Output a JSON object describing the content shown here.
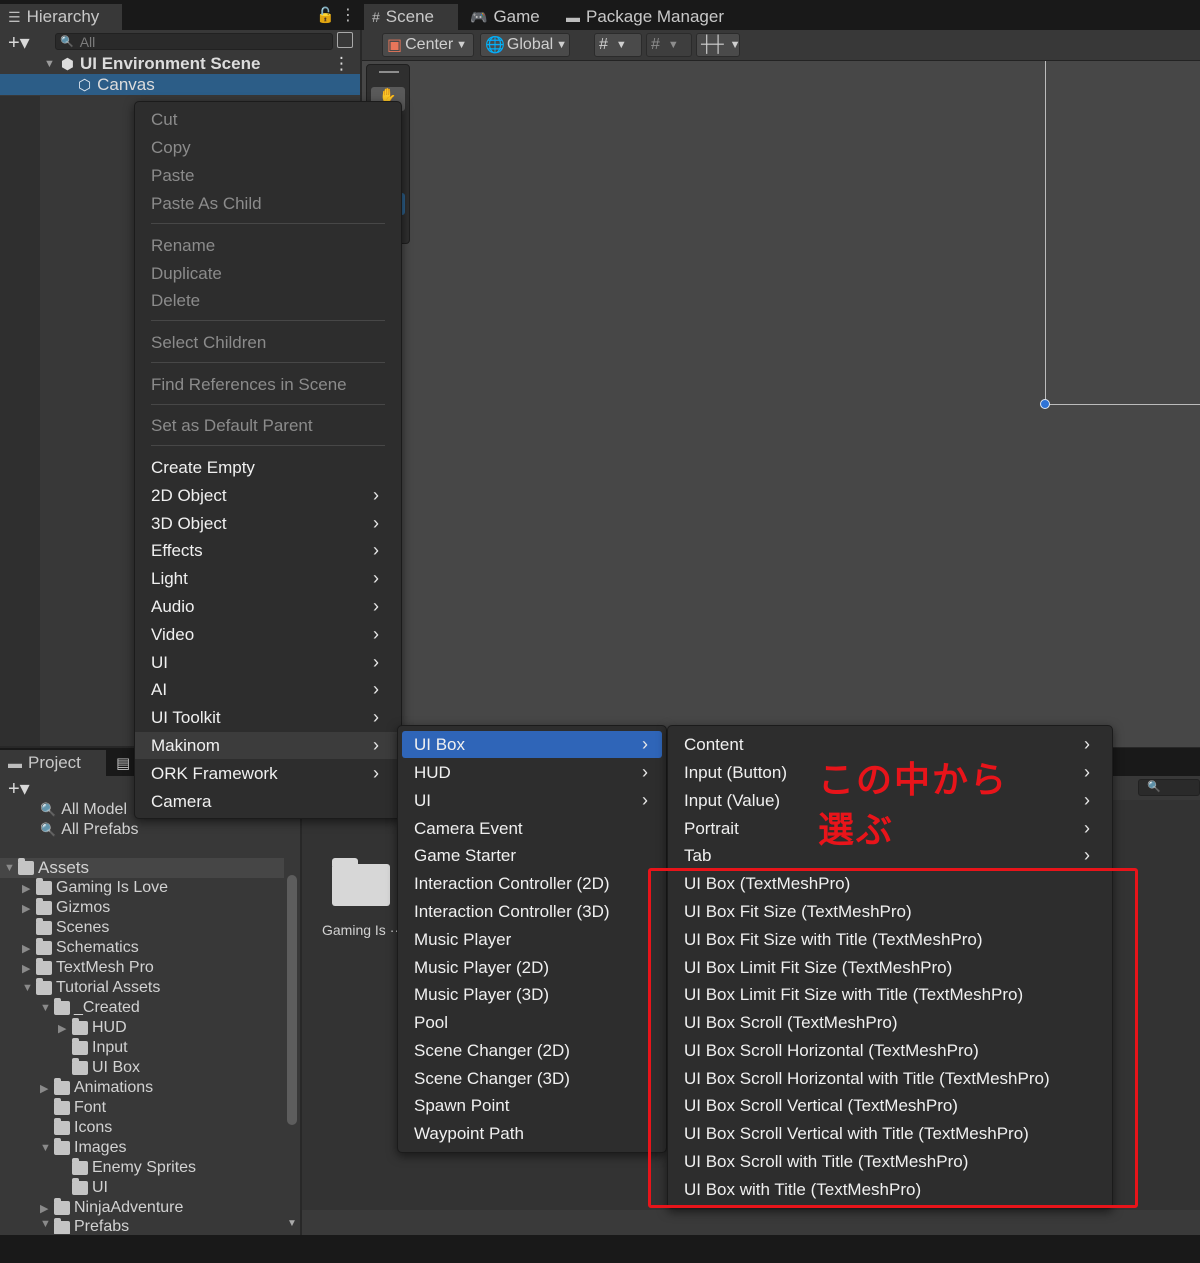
{
  "tabs": {
    "hierarchy": "Hierarchy",
    "scene": "Scene",
    "game": "Game",
    "package_manager": "Package Manager",
    "project": "Project"
  },
  "hierarchy": {
    "search_placeholder": "All",
    "scene_name": "UI Environment Scene",
    "selected_object": "Canvas"
  },
  "scene_toolbar": {
    "pivot": "Center",
    "space": "Global"
  },
  "context_menu": {
    "items": [
      {
        "label": "Cut",
        "enabled": false
      },
      {
        "label": "Copy",
        "enabled": false
      },
      {
        "label": "Paste",
        "enabled": false
      },
      {
        "label": "Paste As Child",
        "enabled": false
      },
      {
        "label": "Rename",
        "enabled": false
      },
      {
        "label": "Duplicate",
        "enabled": false
      },
      {
        "label": "Delete",
        "enabled": false
      },
      {
        "label": "Select Children",
        "enabled": false
      },
      {
        "label": "Find References in Scene",
        "enabled": false
      },
      {
        "label": "Set as Default Parent",
        "enabled": false
      },
      {
        "label": "Create Empty",
        "enabled": true
      },
      {
        "label": "2D Object",
        "enabled": true,
        "submenu": true
      },
      {
        "label": "3D Object",
        "enabled": true,
        "submenu": true
      },
      {
        "label": "Effects",
        "enabled": true,
        "submenu": true
      },
      {
        "label": "Light",
        "enabled": true,
        "submenu": true
      },
      {
        "label": "Audio",
        "enabled": true,
        "submenu": true
      },
      {
        "label": "Video",
        "enabled": true,
        "submenu": true
      },
      {
        "label": "UI",
        "enabled": true,
        "submenu": true
      },
      {
        "label": "AI",
        "enabled": true,
        "submenu": true
      },
      {
        "label": "UI Toolkit",
        "enabled": true,
        "submenu": true
      },
      {
        "label": "Makinom",
        "enabled": true,
        "submenu": true
      },
      {
        "label": "ORK Framework",
        "enabled": true,
        "submenu": true
      },
      {
        "label": "Camera",
        "enabled": true
      }
    ]
  },
  "makinom_menu": {
    "items": [
      {
        "label": "UI Box",
        "submenu": true
      },
      {
        "label": "HUD",
        "submenu": true
      },
      {
        "label": "UI",
        "submenu": true
      },
      {
        "label": "Camera Event"
      },
      {
        "label": "Game Starter"
      },
      {
        "label": "Interaction Controller (2D)"
      },
      {
        "label": "Interaction Controller (3D)"
      },
      {
        "label": "Music Player"
      },
      {
        "label": "Music Player (2D)"
      },
      {
        "label": "Music Player (3D)"
      },
      {
        "label": "Pool"
      },
      {
        "label": "Scene Changer (2D)"
      },
      {
        "label": "Scene Changer (3D)"
      },
      {
        "label": "Spawn Point"
      },
      {
        "label": "Waypoint Path"
      }
    ]
  },
  "uibox_menu": {
    "items": [
      {
        "label": "Content",
        "submenu": true
      },
      {
        "label": "Input (Button)",
        "submenu": true
      },
      {
        "label": "Input (Value)",
        "submenu": true
      },
      {
        "label": "Portrait",
        "submenu": true
      },
      {
        "label": "Tab",
        "submenu": true
      },
      {
        "label": "UI Box (TextMeshPro)"
      },
      {
        "label": "UI Box Fit Size (TextMeshPro)"
      },
      {
        "label": "UI Box Fit Size with Title (TextMeshPro)"
      },
      {
        "label": "UI Box Limit Fit Size (TextMeshPro)"
      },
      {
        "label": "UI Box Limit Fit Size with Title (TextMeshPro)"
      },
      {
        "label": "UI Box Scroll (TextMeshPro)"
      },
      {
        "label": "UI Box Scroll Horizontal (TextMeshPro)"
      },
      {
        "label": "UI Box Scroll Horizontal with Title (TextMeshPro)"
      },
      {
        "label": "UI Box Scroll Vertical (TextMeshPro)"
      },
      {
        "label": "UI Box Scroll Vertical with Title (TextMeshPro)"
      },
      {
        "label": "UI Box Scroll with Title (TextMeshPro)"
      },
      {
        "label": "UI Box with Title (TextMeshPro)"
      }
    ]
  },
  "annotation": {
    "line1": "この中から",
    "line2": "選ぶ",
    "color": "#e8141a"
  },
  "project": {
    "favorites": [
      "All Model",
      "All Prefabs"
    ],
    "tree": [
      {
        "label": "Assets",
        "depth": 0,
        "expanded": true
      },
      {
        "label": "Gaming Is Love",
        "depth": 1,
        "expanded": false
      },
      {
        "label": "Gizmos",
        "depth": 1,
        "expanded": false
      },
      {
        "label": "Scenes",
        "depth": 1,
        "leaf": true
      },
      {
        "label": "Schematics",
        "depth": 1,
        "expanded": false
      },
      {
        "label": "TextMesh Pro",
        "depth": 1,
        "expanded": false
      },
      {
        "label": "Tutorial Assets",
        "depth": 1,
        "expanded": true
      },
      {
        "label": "_Created",
        "depth": 2,
        "expanded": true
      },
      {
        "label": "HUD",
        "depth": 3,
        "expanded": false
      },
      {
        "label": "Input",
        "depth": 3,
        "leaf": true
      },
      {
        "label": "UI Box",
        "depth": 3,
        "leaf": true
      },
      {
        "label": "Animations",
        "depth": 2,
        "expanded": false
      },
      {
        "label": "Font",
        "depth": 2,
        "leaf": true
      },
      {
        "label": "Icons",
        "depth": 2,
        "leaf": true
      },
      {
        "label": "Images",
        "depth": 2,
        "expanded": true
      },
      {
        "label": "Enemy Sprites",
        "depth": 3,
        "leaf": true
      },
      {
        "label": "UI",
        "depth": 3,
        "leaf": true
      },
      {
        "label": "NinjaAdventure",
        "depth": 2,
        "expanded": false
      },
      {
        "label": "Prefabs",
        "depth": 2,
        "expanded": true
      }
    ],
    "grid_item": "Gaming Is ···"
  }
}
